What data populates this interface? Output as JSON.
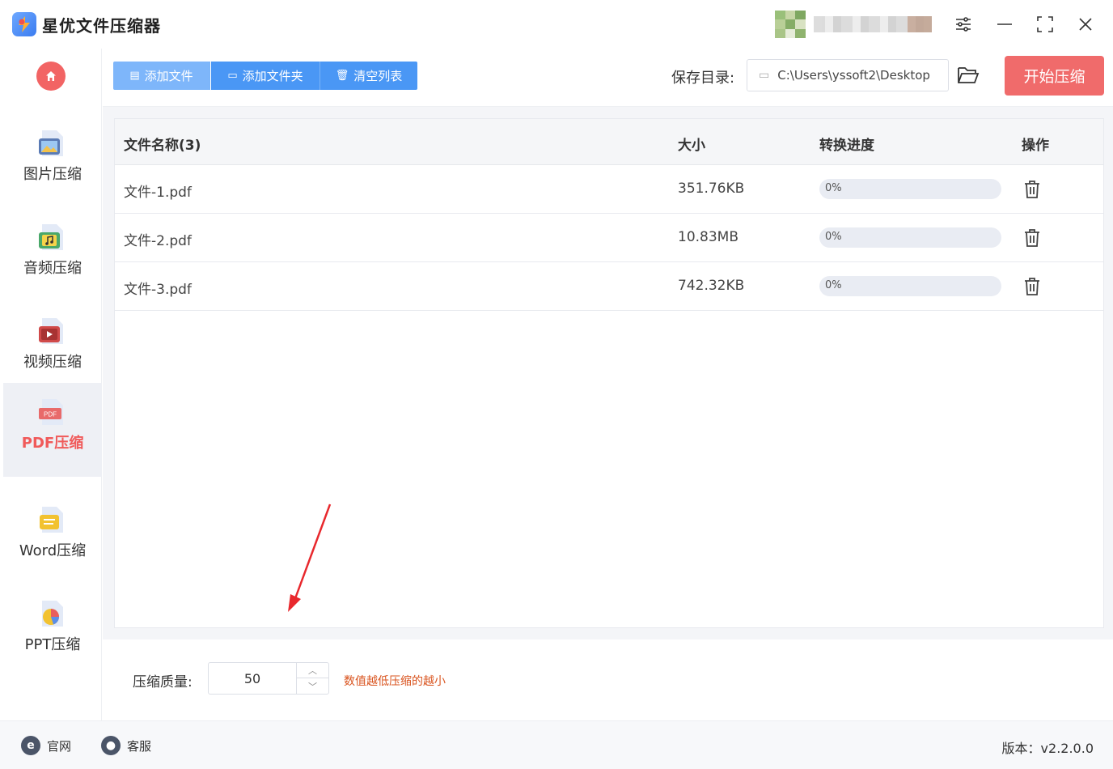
{
  "app": {
    "title": "星优文件压缩器"
  },
  "window": {
    "settings_icon": "sliders-icon",
    "minimize_icon": "minimize-icon",
    "maximize_icon": "maximize-icon",
    "close_icon": "close-icon"
  },
  "sidebar": {
    "items": [
      {
        "label": "图片压缩",
        "icon": "image-file-icon"
      },
      {
        "label": "音频压缩",
        "icon": "audio-file-icon"
      },
      {
        "label": "视频压缩",
        "icon": "video-file-icon"
      },
      {
        "label": "PDF压缩",
        "icon": "pdf-file-icon",
        "active": true
      },
      {
        "label": "Word压缩",
        "icon": "word-file-icon"
      },
      {
        "label": "PPT压缩",
        "icon": "ppt-file-icon"
      }
    ]
  },
  "toolbar": {
    "add_file": "添加文件",
    "add_folder": "添加文件夹",
    "clear_list": "清空列表",
    "save_dir_label": "保存目录:",
    "save_dir_path": "C:\\Users\\yssoft2\\Desktop",
    "start": "开始压缩"
  },
  "table": {
    "headers": {
      "name": "文件名称(3)",
      "size": "大小",
      "progress": "转换进度",
      "action": "操作"
    },
    "rows": [
      {
        "name": "文件-1.pdf",
        "size": "351.76KB",
        "progress_text": "0%",
        "progress": 0
      },
      {
        "name": "文件-2.pdf",
        "size": "10.83MB",
        "progress_text": "0%",
        "progress": 0
      },
      {
        "name": "文件-3.pdf",
        "size": "742.32KB",
        "progress_text": "0%",
        "progress": 0
      }
    ]
  },
  "settings": {
    "quality_label": "压缩质量:",
    "quality_value": "50",
    "quality_hint": "数值越低压缩的越小"
  },
  "footer": {
    "website": "官网",
    "support": "客服",
    "version": "版本：v2.2.0.0"
  },
  "colors": {
    "accent": "#4a97f5",
    "danger": "#f06b6b",
    "active_nav": "#f05a5a",
    "hint": "#d9531e"
  }
}
